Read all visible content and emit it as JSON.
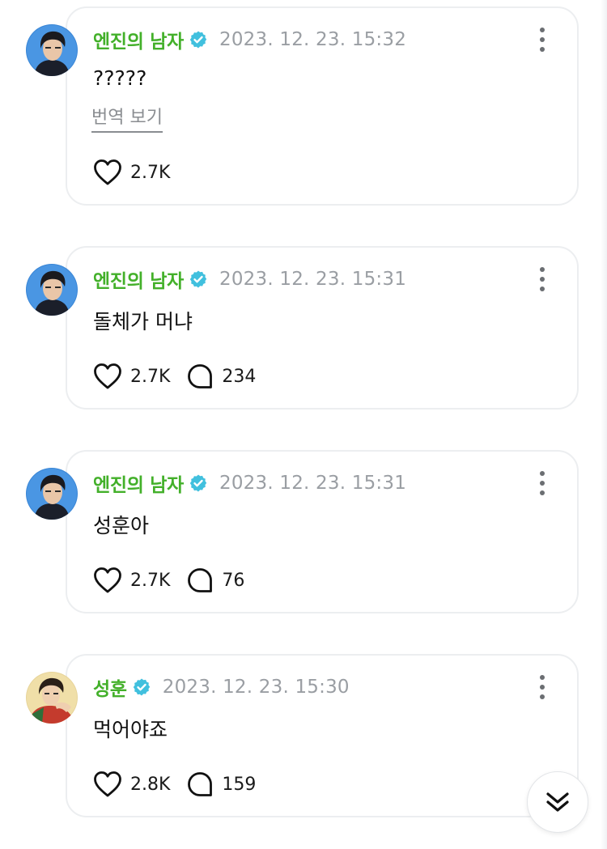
{
  "posts": [
    {
      "author": "엔진의 남자",
      "verified": true,
      "timestamp": "2023. 12. 23. 15:32",
      "text": "?????",
      "translate_label": "번역 보기",
      "likes": "2.7K",
      "comments": null,
      "avatar": "avatar-enjin"
    },
    {
      "author": "엔진의 남자",
      "verified": true,
      "timestamp": "2023. 12. 23. 15:31",
      "text": "돌체가 머냐",
      "likes": "2.7K",
      "comments": "234",
      "avatar": "avatar-enjin"
    },
    {
      "author": "엔진의 남자",
      "verified": true,
      "timestamp": "2023. 12. 23. 15:31",
      "text": "성훈아",
      "likes": "2.7K",
      "comments": "76",
      "avatar": "avatar-enjin"
    },
    {
      "author": "성훈",
      "verified": true,
      "timestamp": "2023. 12. 23. 15:30",
      "text": "먹어야죠",
      "likes": "2.8K",
      "comments": "159",
      "avatar": "avatar-sunghoon"
    }
  ],
  "icons": {
    "verified": "verified-badge-icon",
    "more": "more-vertical-icon",
    "like": "heart-icon",
    "comment": "comment-bubble-icon",
    "scroll": "double-chevron-down-icon"
  },
  "colors": {
    "author_name": "#43b02a",
    "verified_badge": "#41c0de",
    "timestamp": "#9a9ea3",
    "card_border": "#eceef0"
  }
}
